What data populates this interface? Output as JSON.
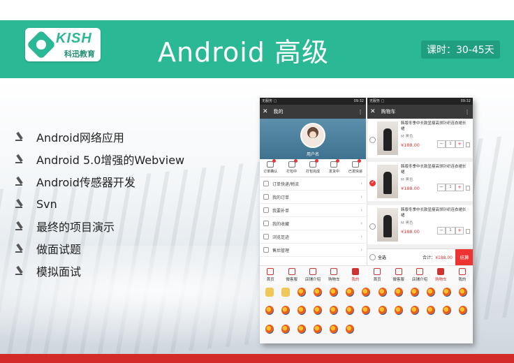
{
  "header": {
    "logo": {
      "word": "KISH",
      "sub": "科迅教育"
    },
    "title": "Android 高级",
    "hours": "课时：30-45天"
  },
  "bullets": [
    "Android网络应用",
    "Android 5.0增强的Webview",
    "Android传感器开发",
    "Svn",
    "最终的项目演示",
    "做面试题",
    "模拟面试"
  ],
  "phone": {
    "status_left": "无服务 ▢",
    "status_right": "09:32",
    "profile_pane": {
      "title": "我的",
      "username": "用户名",
      "orders": [
        "订单确认",
        "打包中",
        "打包完成",
        "发货中",
        "已发快递"
      ],
      "menu": [
        "订单快递/物流",
        "我的订单",
        "我要补单",
        "我的收藏",
        "浏览足迹",
        "售后管理"
      ]
    },
    "cart_pane": {
      "title": "购物车",
      "items": [
        {
          "name": "韩版冬季中长款显瘦高领针织连衣裙长裙",
          "spec": "M  黑色",
          "price": "¥188.00",
          "qty": "1",
          "checked": false
        },
        {
          "name": "韩版冬季中长款显瘦高领针织连衣裙长裙",
          "spec": "M  黑色",
          "price": "¥188.00",
          "qty": "1",
          "checked": true
        },
        {
          "name": "韩版冬季中长款显瘦高领针织连衣裙长裙",
          "spec": "M  黑色",
          "price": "¥188.00",
          "qty": "1",
          "checked": false
        }
      ],
      "select_all": "全选",
      "total_label": "合计：",
      "total": "¥188.00",
      "checkout": "结算"
    },
    "tabs_left": [
      "首页",
      "微客服",
      "店铺介绍",
      "购物车",
      "我的"
    ],
    "tabs_right": [
      "首页",
      "微客服",
      "店铺介绍",
      "购物车",
      "我的"
    ]
  },
  "colors": {
    "brand": "#2bb895",
    "accent_red": "#e33333",
    "bottom_band": "#d32a2a"
  }
}
